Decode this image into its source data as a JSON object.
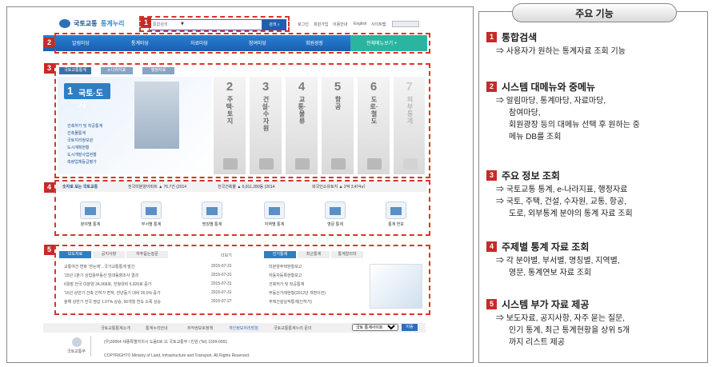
{
  "site": {
    "logo_text": "국토교통",
    "logo_text2": "통계누리",
    "search_placeholder": "통합검색",
    "search_btn": "검색",
    "top_links": [
      "로그인",
      "회원가입",
      "이용안내",
      "English",
      "사이트맵"
    ],
    "nav": [
      "알림마당",
      "통계마당",
      "자료마당",
      "참여마당",
      "회원광장",
      "전체메뉴보기 +"
    ],
    "tabs": [
      "국토교통통계",
      "e-나라지표",
      "행정자료"
    ],
    "feature_title": "국토·도시",
    "feature_links": [
      "건축허가 및 착공통계",
      "건축물통계",
      "국토지리정보원",
      "도시계획현황",
      "도시개발사업현황",
      "측량업체등급평가"
    ],
    "columns": [
      {
        "num": "2",
        "label": "주택·토지"
      },
      {
        "num": "3",
        "label": "건설·수자원"
      },
      {
        "num": "4",
        "label": "교통·물류"
      },
      {
        "num": "5",
        "label": "항공"
      },
      {
        "num": "6",
        "label": "도로·철도"
      },
      {
        "num": "7",
        "label": "외부통계"
      }
    ],
    "stats_title": "숫자로 보는 국토교통",
    "stats": [
      "전국미분양아파트 ▲ 76.7건 (2014",
      "전국건축물 ▲ 6,911,280동 (2014",
      "외국인소유토지 ▲ 2억 3,474㎡"
    ],
    "categories": [
      "분야별 통계",
      "부서별 통계",
      "명칭별 통계",
      "지역별 통계",
      "영문 통계",
      "통계 연보"
    ],
    "news_tabs": [
      "보도자료",
      "공지사항",
      "자주묻는질문"
    ],
    "news_more": "더보기",
    "news_rows": [
      {
        "title": "교통여건 변화 '한눈에'...국가교통통계 발간",
        "date": "2015-07-31"
      },
      {
        "title": "'15년 1분기 상업용부동산 임대동향조사 결과",
        "date": "2015-07-31"
      },
      {
        "title": "6월말 전국 미분양 34,068호, 전월대비 5,926호 증가",
        "date": "2015-07-31"
      },
      {
        "title": "'15년 상반기 건축 인허가 면적, 전년동기 대비 26.0% 증가",
        "date": "2015-07-31"
      },
      {
        "title": "올해 상반기 전국 땅값 1.07% 상승, 56개월 연속 소폭 상승",
        "date": "2015-07-27"
      }
    ],
    "right_tabs": [
      "인기통계",
      "최근통계",
      "통계알리미"
    ],
    "right_rows": [
      "미분양주택현황보고",
      "자동차등록현황보고",
      "건축허가 및 착공통계",
      "부동산거래현황(2012년 개편이전)",
      "주택건설실적통계(인허가)"
    ],
    "footer_links": [
      "국토교통통계소개",
      "통계누리안내",
      "저작권보호정책",
      "개인정보처리방침",
      "국토교통통계누리 문의"
    ],
    "footer_site": "국토 통계사이트",
    "footer_go": "이동",
    "footer_address": "(우)30064 세종특별자치시 도움6로 11 국토교통부 / 민원 (Tel) 1599-0001",
    "copyright": "COPYRIGHT© Ministry of Land, Infrastructure and Transport. All Rights Reserved.",
    "footer_logo": "국토교통부"
  },
  "panel": {
    "title": "주요 기능",
    "sections": [
      {
        "num": "1",
        "head": "통합검색",
        "body": [
          "⇒ 사용자가 원하는 통계자료 조회 기능"
        ]
      },
      {
        "num": "2",
        "head": "시스템 대메뉴와 중메뉴",
        "body": [
          "⇒ 알림마당, 통계마당, 자료마당,",
          "참여마당,",
          "회원광장 등의 대메뉴 선택 후 원하는 중",
          "메뉴 DB를 조회"
        ]
      },
      {
        "num": "3",
        "head": "주요 정보 조회",
        "body": [
          "⇒ 국토교통 통계, e-나라지표, 행정자료",
          "⇒ 국토, 주택, 건설, 수자원, 교통, 항공,",
          "도로, 외부통계 분야의 통계 자료 조회"
        ]
      },
      {
        "num": "4",
        "head": "주제별 통계 자료 조회",
        "body": [
          "⇒ 각 분야별, 부서별, 명칭별, 지역별,",
          "영문, 통계연보 자료 조회"
        ]
      },
      {
        "num": "5",
        "head": "시스템 부가 자료 제공",
        "body": [
          "⇒ 보도자료, 공지사항, 자주 묻는 질문,",
          "인기 통계, 최근 통계현황을 상위 5개",
          "까지 리스트 제공"
        ]
      }
    ]
  },
  "colors": {
    "accent": "#c62a2a",
    "nav": "#1a5fae",
    "feature": "#2f7ec2"
  }
}
